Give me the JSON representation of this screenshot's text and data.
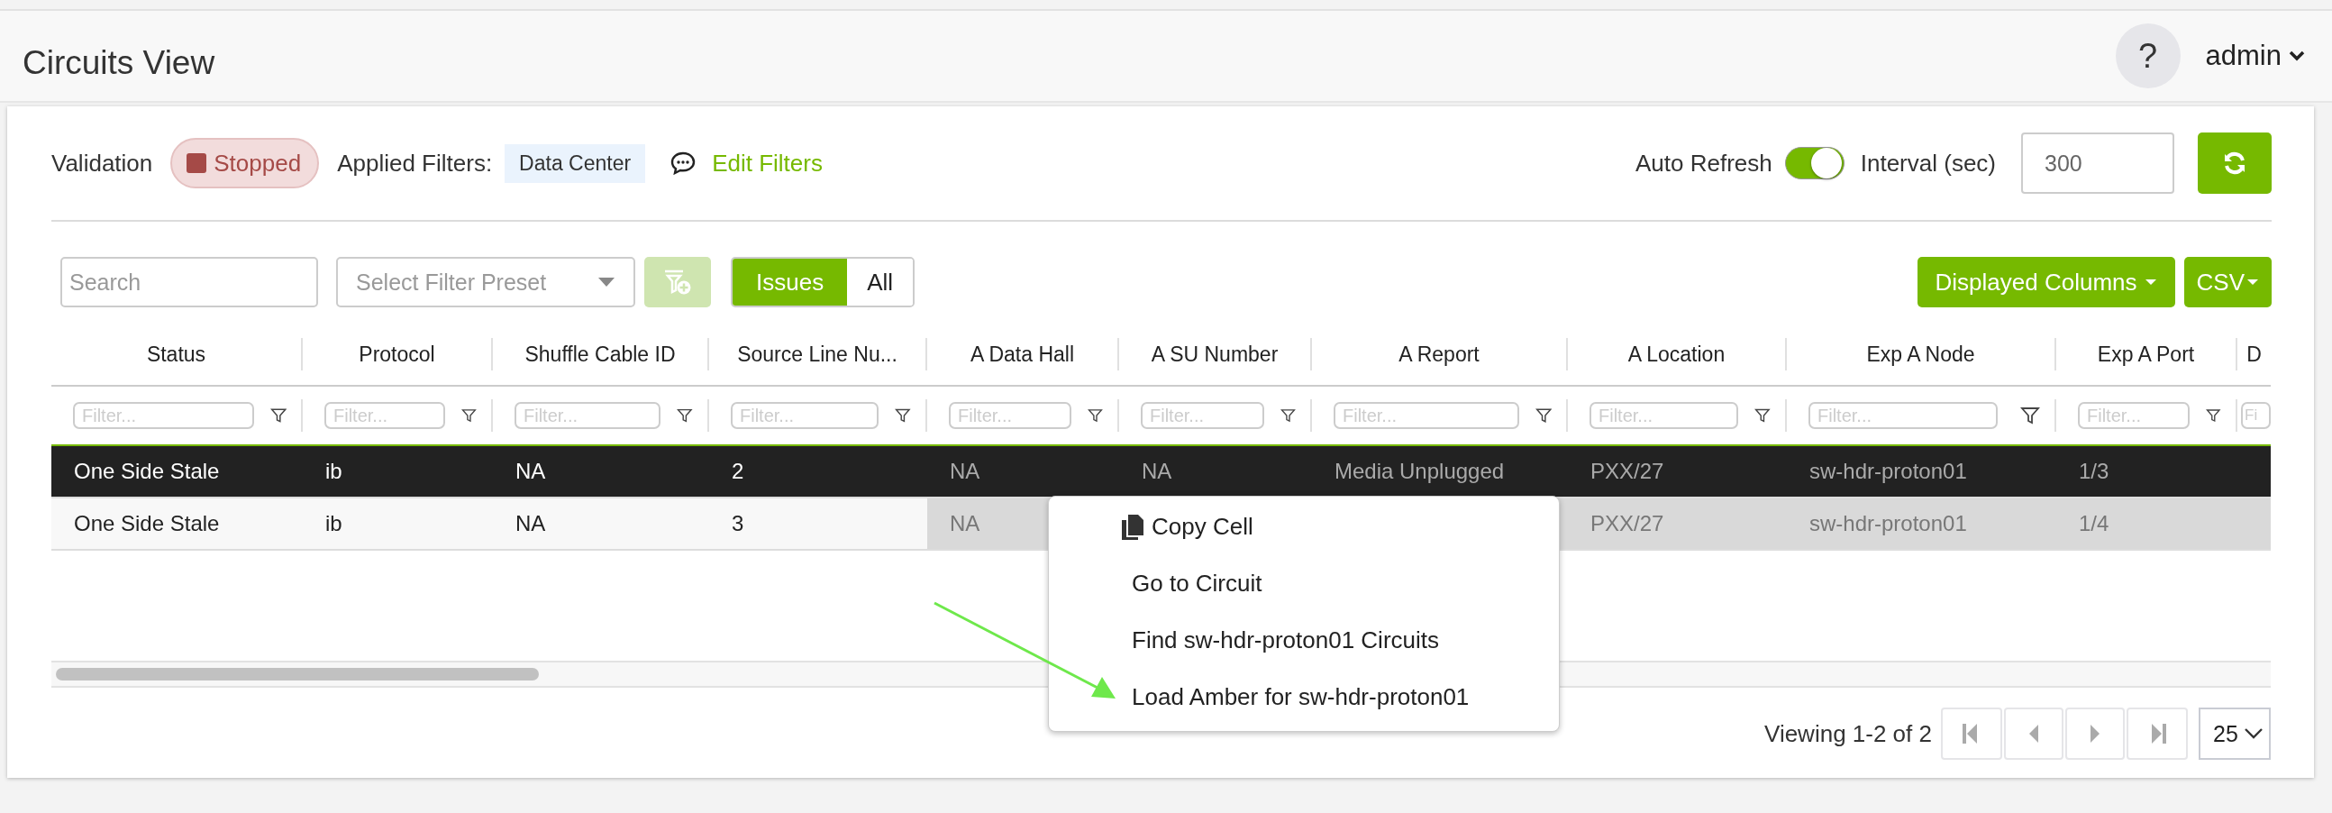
{
  "header": {
    "title": "Circuits View",
    "help": "?",
    "user": "admin"
  },
  "validation": {
    "label": "Validation",
    "status": {
      "text": "Stopped",
      "kind": "stopped"
    }
  },
  "applied_filters": {
    "label": "Applied Filters:",
    "tags": [
      "Data Center"
    ],
    "edit": "Edit Filters"
  },
  "auto_refresh": {
    "label": "Auto Refresh",
    "on": true
  },
  "interval": {
    "label": "Interval (sec)",
    "value": "300"
  },
  "toolbar": {
    "search": {
      "placeholder": "Search"
    },
    "preset": {
      "placeholder": "Select Filter Preset"
    },
    "view_tabs": [
      {
        "label": "Issues",
        "selected": true
      },
      {
        "label": "All",
        "selected": false
      }
    ],
    "displayed_columns": "Displayed Columns",
    "csv": "CSV"
  },
  "table": {
    "columns": [
      {
        "label": "Status",
        "filter_placeholder": "Filter...",
        "pinned": true
      },
      {
        "label": "Protocol",
        "filter_placeholder": "Filter...",
        "pinned": true
      },
      {
        "label": "Shuffle Cable ID",
        "filter_placeholder": "Filter...",
        "pinned": true
      },
      {
        "label": "Source Line Nu...",
        "filter_placeholder": "Filter...",
        "pinned": true
      },
      {
        "label": "A Data Hall",
        "filter_placeholder": "Filter...",
        "pinned": false
      },
      {
        "label": "A SU Number",
        "filter_placeholder": "Filter...",
        "pinned": false
      },
      {
        "label": "A Report",
        "filter_placeholder": "Filter...",
        "pinned": false
      },
      {
        "label": "A Location",
        "filter_placeholder": "Filter...",
        "pinned": false
      },
      {
        "label": "Exp A Node",
        "filter_placeholder": "Filter...",
        "pinned": false
      },
      {
        "label": "Exp A Port",
        "filter_placeholder": "Filter...",
        "pinned": false
      },
      {
        "label": "D",
        "filter_placeholder": "Fi",
        "pinned": false
      }
    ],
    "rows": [
      {
        "selected": true,
        "hovered": false,
        "cells": [
          "One Side Stale",
          "ib",
          "NA",
          "2",
          "NA",
          "NA",
          "Media Unplugged",
          "PXX/27",
          "sw-hdr-proton01",
          "1/3",
          null
        ]
      },
      {
        "selected": false,
        "hovered": true,
        "cells": [
          "One Side Stale",
          "ib",
          "NA",
          "3",
          "NA",
          null,
          null,
          "PXX/27",
          "sw-hdr-proton01",
          "1/4",
          null
        ]
      }
    ]
  },
  "pagination": {
    "summary": "Viewing 1-2 of 2",
    "page_size": "25"
  },
  "context_menu": {
    "items": [
      {
        "label": "Copy Cell",
        "kind": "copy"
      },
      {
        "label": "Go to Circuit",
        "kind": "plain"
      },
      {
        "label": "Find sw-hdr-proton01 Circuits",
        "kind": "plain"
      },
      {
        "label": "Load Amber for sw-hdr-proton01",
        "kind": "plain"
      }
    ]
  }
}
